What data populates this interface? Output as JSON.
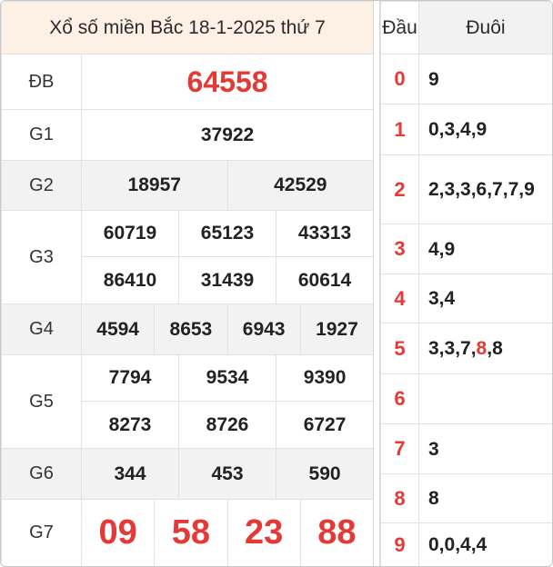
{
  "title": "Xổ số miền Bắc 18-1-2025 thứ 7",
  "prizes": {
    "db": {
      "label": "ĐB",
      "values": [
        "64558"
      ]
    },
    "g1": {
      "label": "G1",
      "values": [
        "37922"
      ]
    },
    "g2": {
      "label": "G2",
      "values": [
        "18957",
        "42529"
      ]
    },
    "g3": {
      "label": "G3",
      "values": [
        "60719",
        "65123",
        "43313",
        "86410",
        "31439",
        "60614"
      ]
    },
    "g4": {
      "label": "G4",
      "values": [
        "4594",
        "8653",
        "6943",
        "1927"
      ]
    },
    "g5": {
      "label": "G5",
      "values": [
        "7794",
        "9534",
        "9390",
        "8273",
        "8726",
        "6727"
      ]
    },
    "g6": {
      "label": "G6",
      "values": [
        "344",
        "453",
        "590"
      ]
    },
    "g7": {
      "label": "G7",
      "values": [
        "09",
        "58",
        "23",
        "88"
      ]
    }
  },
  "loto": {
    "head_label": "Đầu",
    "tail_label": "Đuôi",
    "rows": [
      {
        "head": "0",
        "tail": "9"
      },
      {
        "head": "1",
        "tail": "0,3,4,9"
      },
      {
        "head": "2",
        "tail": "2,3,3,6,7,7,9"
      },
      {
        "head": "3",
        "tail": "4,9"
      },
      {
        "head": "4",
        "tail": "3,4"
      },
      {
        "head": "5",
        "tail_pre": "3,3,7,",
        "tail_highlight": "8",
        "tail_post": ",8"
      },
      {
        "head": "6",
        "tail": ""
      },
      {
        "head": "7",
        "tail": "3"
      },
      {
        "head": "8",
        "tail": "8"
      },
      {
        "head": "9",
        "tail": "0,0,4,4"
      }
    ]
  },
  "colors": {
    "accent_red": "#e53935",
    "header_bg": "#fdf1e6",
    "row_shade": "#f2f2f2"
  }
}
